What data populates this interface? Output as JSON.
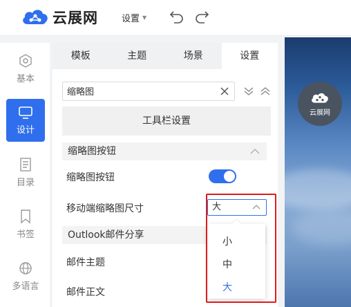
{
  "app": {
    "logo_text": "云展网",
    "settings_label": "设置"
  },
  "nav": [
    {
      "label": "基本",
      "icon": "gear-icon"
    },
    {
      "label": "设计",
      "icon": "monitor-icon",
      "active": true
    },
    {
      "label": "目录",
      "icon": "toc-icon"
    },
    {
      "label": "书签",
      "icon": "bookmark-icon"
    },
    {
      "label": "多语言",
      "icon": "globe-icon"
    }
  ],
  "tabs": [
    {
      "label": "模板"
    },
    {
      "label": "主题"
    },
    {
      "label": "场景"
    },
    {
      "label": "设置",
      "active": true
    }
  ],
  "search": {
    "value": "缩略图"
  },
  "toolbar_settings_label": "工具栏设置",
  "sections": {
    "thumbnail_button": "缩略图按钮",
    "outlook": "Outlook邮件分享"
  },
  "rows": {
    "thumbnail_button_label": "缩略图按钮",
    "thumbnail_button_enabled": true,
    "mobile_thumb_size_label": "移动端缩略图尺寸",
    "mail_subject_label": "邮件主题",
    "mail_body_label": "邮件正文"
  },
  "size_select": {
    "value": "大",
    "options": [
      "小",
      "中",
      "大"
    ]
  },
  "preview": {
    "logo_text": "云展网"
  },
  "colors": {
    "accent": "#2f6fed",
    "highlight": "#e0191a"
  }
}
